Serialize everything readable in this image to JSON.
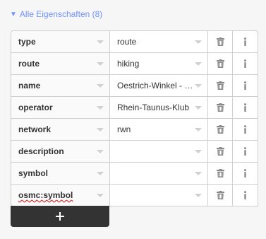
{
  "section": {
    "toggle_icon": "triangle-down-icon",
    "title": "Alle Eigenschaften (8)",
    "accent_color": "#7092ff"
  },
  "tags": [
    {
      "key": "type",
      "value": "route"
    },
    {
      "key": "route",
      "value": "hiking"
    },
    {
      "key": "name",
      "value": "Oestrich-Winkel - Hallgarten - Oestrich-Winkel"
    },
    {
      "key": "operator",
      "value": "Rhein-Taunus-Klub"
    },
    {
      "key": "network",
      "value": "rwn"
    },
    {
      "key": "description",
      "value": ""
    },
    {
      "key": "symbol",
      "value": ""
    },
    {
      "key": "osmc:symbol",
      "value": ""
    }
  ],
  "row_icons": {
    "delete": "trash-icon",
    "info": "info-icon"
  },
  "add_button": {
    "label": "+",
    "icon": "plus-icon"
  }
}
